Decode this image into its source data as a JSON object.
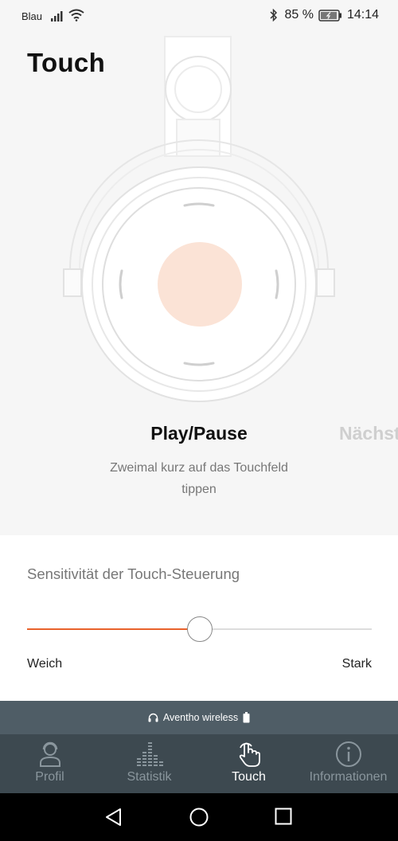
{
  "status": {
    "carrier": "Blau",
    "battery": "85 %",
    "time": "14:14"
  },
  "page": {
    "title": "Touch"
  },
  "gesture": {
    "name": "Play/Pause",
    "next_name": "Nächste",
    "description": "Zweimal kurz auf das Touchfeld tippen",
    "accent_color": "#fbe3d6"
  },
  "sensitivity": {
    "label": "Sensitivität der Touch-Steuerung",
    "min_label": "Weich",
    "max_label": "Stark",
    "value_fraction": 0.5,
    "accent": "#e8622c"
  },
  "device_bar": {
    "label": "Aventho wireless",
    "icon": "headphones-icon"
  },
  "tabs": [
    {
      "label": "Profil",
      "icon": "profile-icon",
      "active": false
    },
    {
      "label": "Statistik",
      "icon": "statistics-icon",
      "active": false
    },
    {
      "label": "Touch",
      "icon": "touch-hand-icon",
      "active": true
    },
    {
      "label": "Informationen",
      "icon": "info-icon",
      "active": false
    }
  ]
}
